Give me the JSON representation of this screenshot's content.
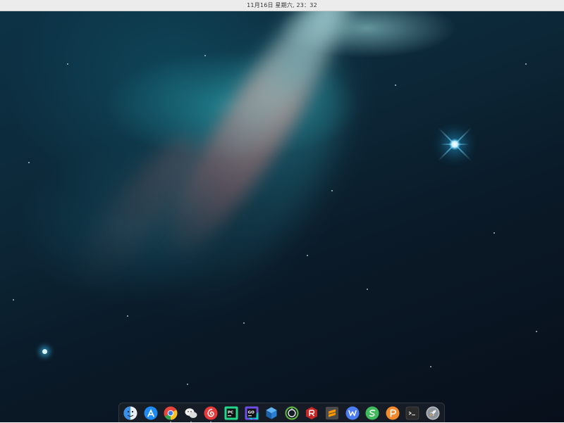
{
  "top_bar": {
    "clock": "11月16日 星期六, 23：32"
  },
  "dock": {
    "items": [
      {
        "icon": "finder-icon",
        "color": "#3a8fe8"
      },
      {
        "icon": "app-store-icon",
        "color": "#1f8bf2"
      },
      {
        "icon": "chrome-icon",
        "color": "#e8453c",
        "running": true
      },
      {
        "icon": "wechat-icon",
        "color": "#f2f2f2",
        "running": true
      },
      {
        "icon": "netease-music-icon",
        "color": "#e83a3a",
        "running": true
      },
      {
        "icon": "pycharm-icon",
        "color": "#21d789"
      },
      {
        "icon": "goland-icon",
        "color": "#6d4ce8"
      },
      {
        "icon": "virtualbox-icon",
        "color": "#2a7fd4"
      },
      {
        "icon": "anaconda-icon",
        "color": "#5fb845"
      },
      {
        "icon": "red-app-icon",
        "color": "#c62828"
      },
      {
        "icon": "sublime-text-icon",
        "color": "#ff9800"
      },
      {
        "icon": "wps-writer-icon",
        "color": "#4a7cf2"
      },
      {
        "icon": "wps-spreadsheet-icon",
        "color": "#3fba5d"
      },
      {
        "icon": "wps-presentation-icon",
        "color": "#f08a2c"
      },
      {
        "icon": "terminal-icon",
        "color": "#2b2b2b"
      },
      {
        "icon": "launcher-rocket-icon",
        "color": "#b8bcc2"
      }
    ]
  }
}
